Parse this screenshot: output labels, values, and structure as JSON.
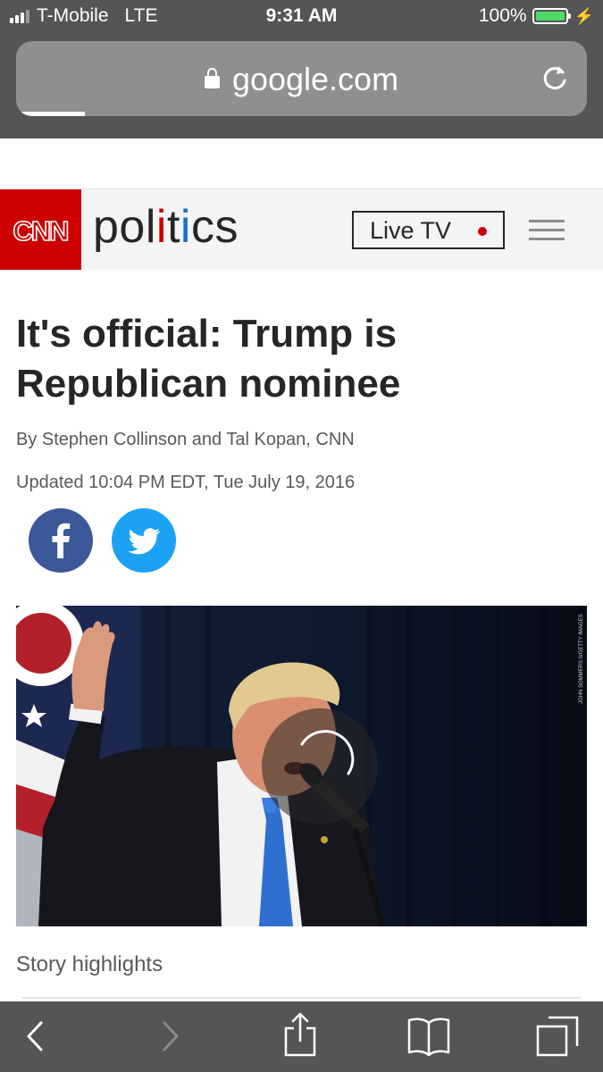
{
  "status_bar": {
    "carrier": "T-Mobile",
    "network": "LTE",
    "time": "9:31 AM",
    "battery_percent": "100%",
    "battery_level": 1.0,
    "signal_bars_active": 3,
    "signal_bars_total": 4
  },
  "browser": {
    "url": "google.com",
    "page_load_progress": 0.12
  },
  "cnn": {
    "logo": "CNN",
    "section": "politics",
    "live_tv_label": "Live TV",
    "brand_red": "#cc0000"
  },
  "article": {
    "headline": "It's official: Trump is Republican nominee",
    "byline": "By Stephen Collinson and Tal Kopan, CNN",
    "updated": "Updated 10:04 PM EDT, Tue July 19, 2016",
    "share": [
      {
        "icon": "facebook-icon",
        "color": "#3b5998"
      },
      {
        "icon": "twitter-icon",
        "color": "#1da1f2"
      }
    ],
    "image_credit": "JOHN SOMMERS II/GETTY IMAGES",
    "story_highlights_label": "Story highlights"
  },
  "toolbar": {
    "icons": [
      "back-icon",
      "forward-icon",
      "share-icon",
      "bookmarks-icon",
      "tabs-icon"
    ]
  }
}
